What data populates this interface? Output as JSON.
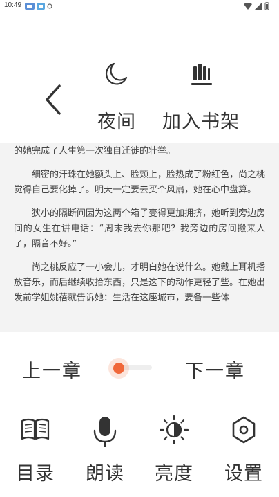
{
  "status_bar": {
    "time": "10:49"
  },
  "toolbar": {
    "night_label": "夜间",
    "shelf_label": "加入书架"
  },
  "content": {
    "paragraphs": [
      "的她完成了人生第一次独自迁徙的壮举。",
      "细密的汗珠在她额头上、脸颊上，脸热成了粉红色，尚之桃觉得自己要化掉了。明天一定要去买个风扇，她在心中盘算。",
      "狭小的隔断间因为这两个箱子变得更加拥挤，她听到旁边房间的女生在讲电话：“周末我去你那吧？我旁边的房间搬来人了，隔音不好。”",
      "尚之桃反应了一小会儿，才明白她在说什么。她戴上耳机播放音乐，而后继续收拾东西，只是这下的动作更轻了些。在她出发前学姐姚蓓就告诉她：生活在这座城市，要备一些体"
    ]
  },
  "chapter_nav": {
    "prev_label": "上一章",
    "next_label": "下一章",
    "progress": 0.0
  },
  "menu": {
    "items": [
      {
        "label": "目录",
        "icon": "book-icon"
      },
      {
        "label": "朗读",
        "icon": "microphone-icon"
      },
      {
        "label": "亮度",
        "icon": "brightness-icon"
      },
      {
        "label": "设置",
        "icon": "settings-icon"
      }
    ]
  },
  "colors": {
    "accent": "#f0683a",
    "text": "#333333",
    "content_bg": "#f3f3f3"
  }
}
